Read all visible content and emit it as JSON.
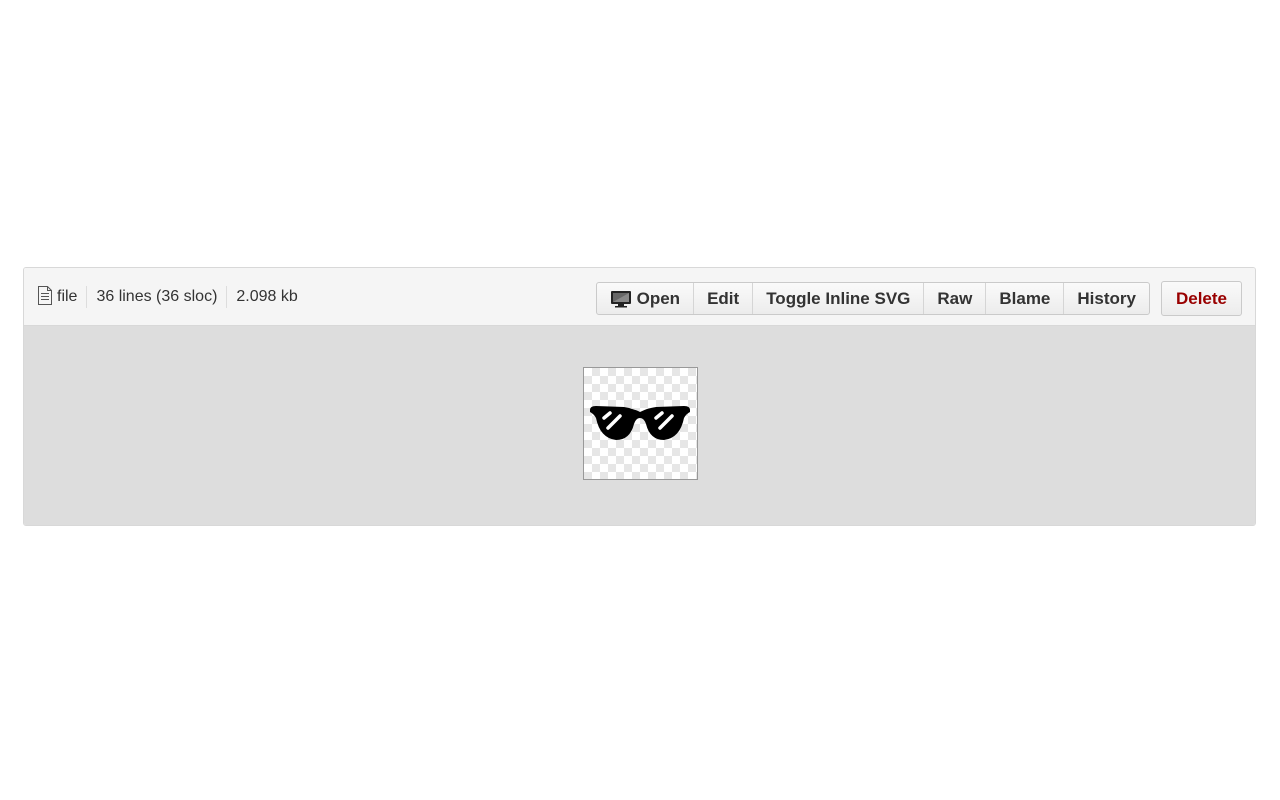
{
  "file_info": {
    "type_label": "file",
    "lines": "36 lines (36 sloc)",
    "size": "2.098 kb"
  },
  "actions": {
    "open": "Open",
    "edit": "Edit",
    "toggle_svg": "Toggle Inline SVG",
    "raw": "Raw",
    "blame": "Blame",
    "history": "History",
    "delete": "Delete"
  },
  "icons": {
    "file": "file-icon",
    "open": "monitor-icon",
    "preview": "sunglasses-icon"
  },
  "colors": {
    "delete": "#990000",
    "header_bg": "#f5f5f5",
    "body_bg": "#dddddd"
  }
}
